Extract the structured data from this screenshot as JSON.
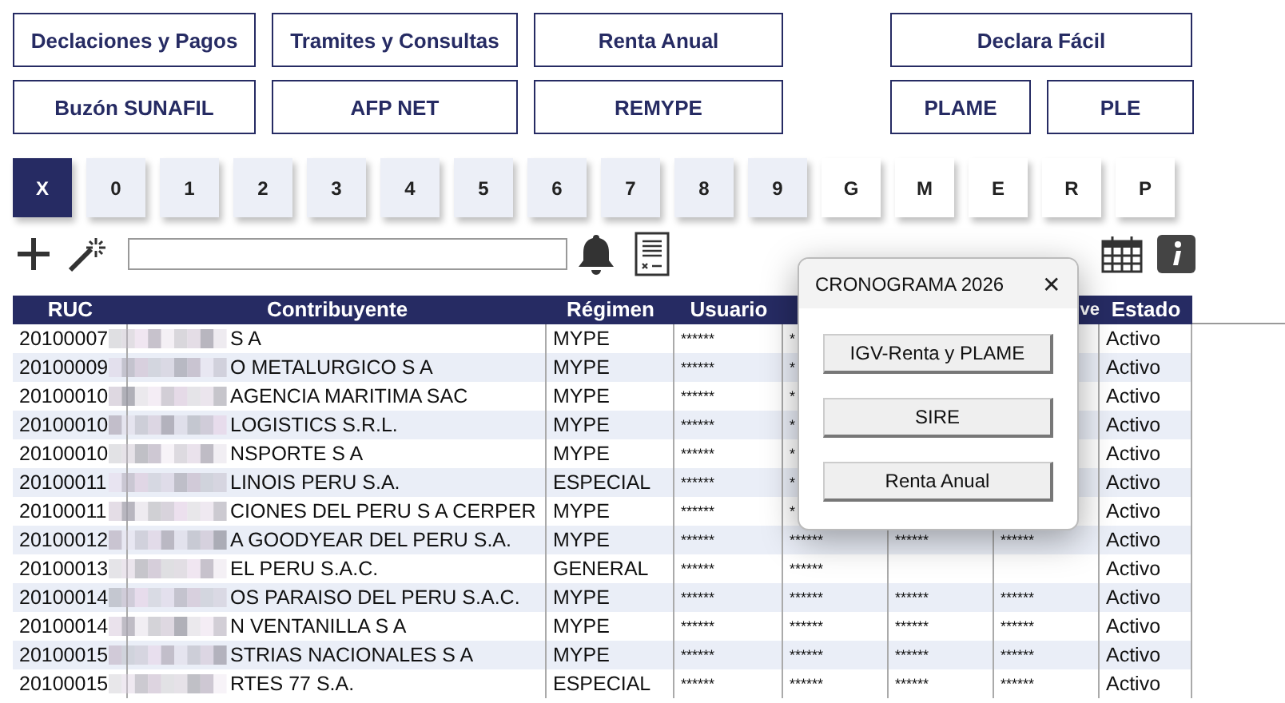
{
  "menu_rows": [
    [
      {
        "label": "Declaciones y Pagos"
      },
      {
        "label": "Tramites y Consultas"
      },
      {
        "label": "Renta Anual"
      },
      {
        "label": "Declara Fácil"
      }
    ],
    [
      {
        "label": "Buzón SUNAFIL"
      },
      {
        "label": "AFP NET"
      },
      {
        "label": "REMYPE"
      },
      {
        "label": "PLAME"
      },
      {
        "label": "PLE"
      }
    ]
  ],
  "tabs": [
    {
      "label": "X",
      "selected": true
    },
    {
      "label": "0",
      "kind": "digit",
      "selected": false
    },
    {
      "label": "1",
      "kind": "digit",
      "selected": false
    },
    {
      "label": "2",
      "kind": "digit",
      "selected": false
    },
    {
      "label": "3",
      "kind": "digit",
      "selected": false
    },
    {
      "label": "4",
      "kind": "digit",
      "selected": false
    },
    {
      "label": "5",
      "kind": "digit",
      "selected": false
    },
    {
      "label": "6",
      "kind": "digit",
      "selected": false
    },
    {
      "label": "7",
      "kind": "digit",
      "selected": false
    },
    {
      "label": "8",
      "kind": "digit",
      "selected": false
    },
    {
      "label": "9",
      "kind": "digit",
      "selected": false
    },
    {
      "label": "G",
      "kind": "letter",
      "selected": false
    },
    {
      "label": "M",
      "kind": "letter",
      "selected": false
    },
    {
      "label": "E",
      "kind": "letter",
      "selected": false
    },
    {
      "label": "R",
      "kind": "letter",
      "selected": false
    },
    {
      "label": "P",
      "kind": "letter",
      "selected": false
    }
  ],
  "table": {
    "columns": [
      {
        "label": "RUC"
      },
      {
        "label": "Contribuyente"
      },
      {
        "label": "Régimen"
      },
      {
        "label": "Usuario"
      },
      {},
      {},
      {
        "label": "ve"
      },
      {
        "label": "Estado"
      }
    ],
    "rows": [
      [
        "20100007",
        "S A",
        "MYPE",
        "******",
        "*",
        "",
        "",
        "Activo"
      ],
      [
        "20100009",
        "O METALURGICO S A",
        "MYPE",
        "******",
        "*",
        "",
        "",
        "Activo"
      ],
      [
        "20100010",
        "AGENCIA MARITIMA SAC",
        "MYPE",
        "******",
        "*",
        "",
        "",
        "Activo"
      ],
      [
        "20100010",
        "LOGISTICS S.R.L.",
        "MYPE",
        "******",
        "*",
        "",
        "",
        "Activo"
      ],
      [
        "20100010",
        "NSPORTE S A",
        "MYPE",
        "******",
        "*",
        "",
        "",
        "Activo"
      ],
      [
        "20100011",
        "LINOIS PERU S.A.",
        "ESPECIAL",
        "******",
        "*",
        "",
        "",
        "Activo"
      ],
      [
        "20100011",
        "CIONES DEL PERU S A CERPER",
        "MYPE",
        "******",
        "*",
        "",
        "",
        "Activo"
      ],
      [
        "20100012",
        "A GOODYEAR DEL PERU S.A.",
        "MYPE",
        "******",
        "******",
        "******",
        "******",
        "Activo"
      ],
      [
        "20100013",
        "EL PERU S.A.C.",
        "GENERAL",
        "******",
        "******",
        "",
        "",
        "Activo"
      ],
      [
        "20100014",
        "OS PARAISO DEL PERU S.A.C.",
        "MYPE",
        "******",
        "******",
        "******",
        "******",
        "Activo"
      ],
      [
        "20100014",
        "N VENTANILLA S A",
        "MYPE",
        "******",
        "******",
        "******",
        "******",
        "Activo"
      ],
      [
        "20100015",
        "STRIAS NACIONALES S A",
        "MYPE",
        "******",
        "******",
        "******",
        "******",
        "Activo"
      ],
      [
        "20100015",
        "RTES 77 S.A.",
        "ESPECIAL",
        "******",
        "******",
        "******",
        "******",
        "Activo"
      ]
    ]
  },
  "dialog": {
    "title": "CRONOGRAMA 2026",
    "close": "✕",
    "buttons": [
      "IGV-Renta y PLAME",
      "SIRE",
      "Renta Anual"
    ]
  }
}
